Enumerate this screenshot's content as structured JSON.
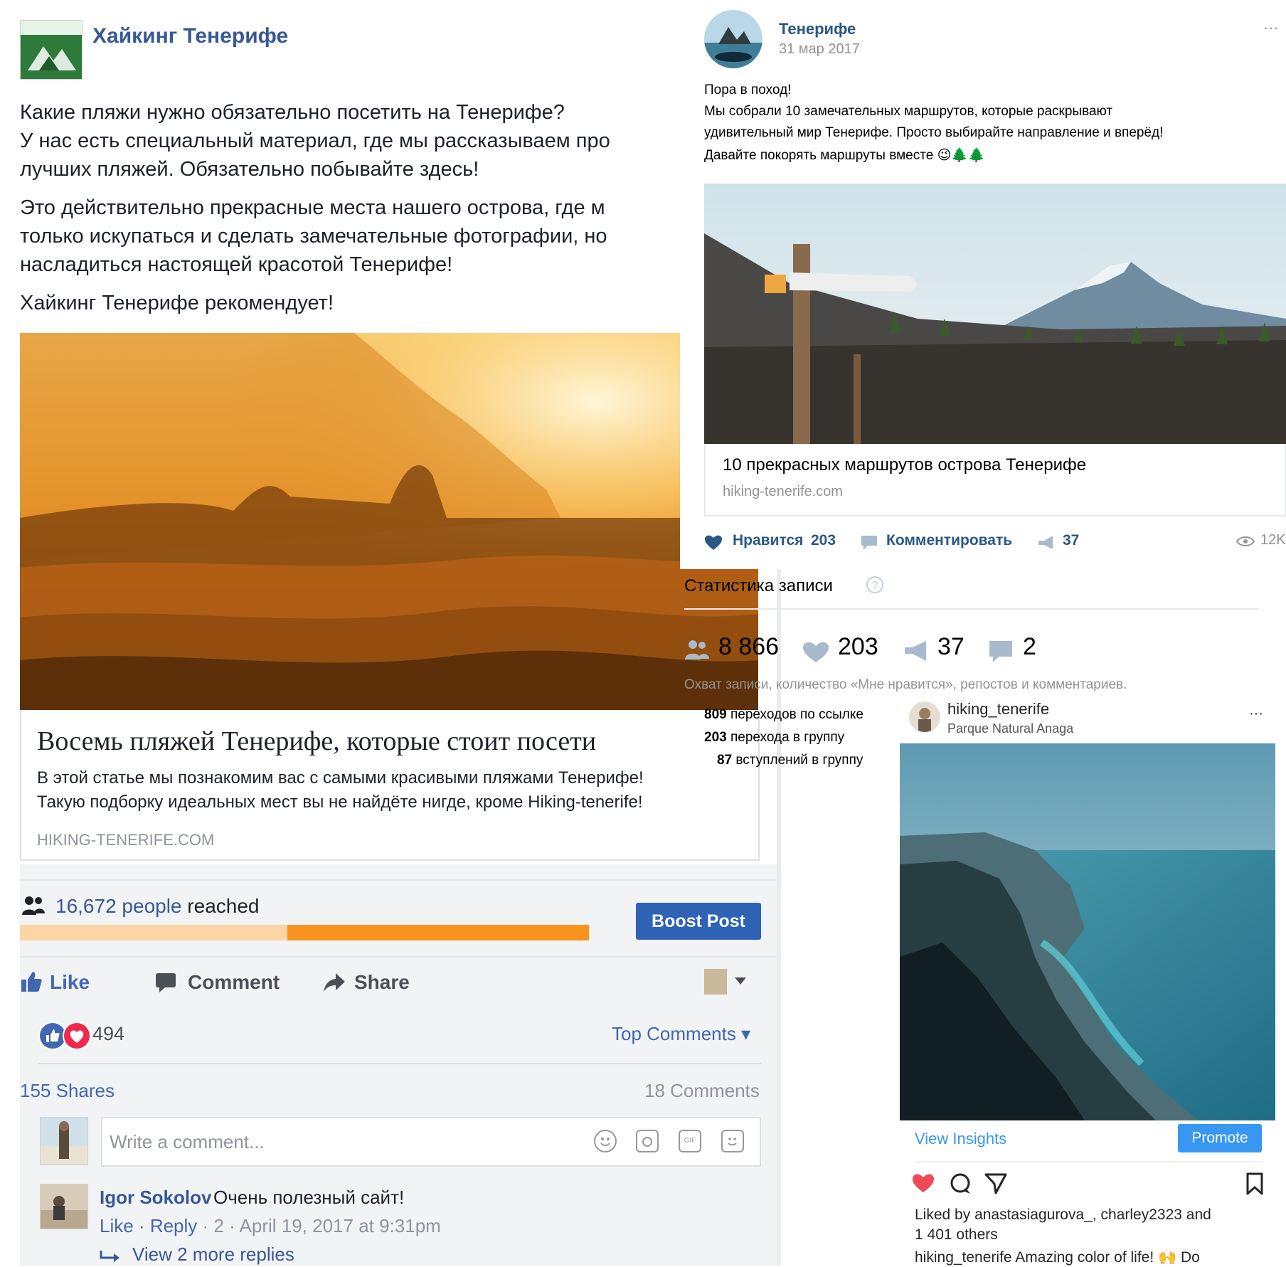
{
  "facebook": {
    "page_name": "Хайкинг Тенерифе",
    "post_lines_p1": [
      "Какие пляжи нужно обязательно посетить на Тенерифе?",
      "У нас есть специальный материал, где мы рассказываем про",
      "лучших пляжей. Обязательно побывайте здесь!"
    ],
    "post_lines_p2": [
      "Это действительно прекрасные места нашего острова, где м",
      "только искупаться и сделать замечательные фотографии, но",
      "насладиться настоящей красотой Тенерифе!"
    ],
    "post_line_p3": "Хайкинг Тенерифе рекомендует!",
    "link": {
      "title": "Восемь пляжей Тенерифе, которые стоит посети",
      "desc_line1": "В этой статье мы познакомим вас с самыми красивыми пляжами Тенерифе!",
      "desc_line2": "Такую подборку идеальных мест вы не найдёте нигде, кроме Hiking-tenerife!",
      "domain": "HIKING-TENERIFE.COM"
    },
    "reach": {
      "people": "16,672 people",
      "suffix": " reached",
      "organic_fraction": 0.47,
      "paid_fraction": 0.53
    },
    "boost_label": "Boost Post",
    "actions": {
      "like": "Like",
      "comment": "Comment",
      "share": "Share"
    },
    "reaction_count": "494",
    "top_comments": "Top Comments ▾",
    "shares": "155 Shares",
    "comments": "18 Comments",
    "comment_placeholder": "Write a comment...",
    "comment": {
      "author": "Igor Sokolov",
      "text": "Очень полезный сайт!",
      "like": "Like",
      "reply": "Reply",
      "meta_rest": " · 2 · April 19, 2017 at 9:31pm",
      "more_replies": "View 2 more replies"
    },
    "colors": {
      "brand": "#4267b2",
      "link": "#365899",
      "boost": "#2e63b6",
      "reach_bar": "#f7931e"
    }
  },
  "vk": {
    "name": "Тенерифе",
    "date": "31 мар 2017",
    "post_lines": [
      "Пора в поход!",
      "Мы собрали 10 замечательных маршрутов, которые раскрывают",
      "удивительный мир Тенерифе. Просто выбирайте направление и вперёд!",
      "Давайте покорять маршруты вместе 😉🌲🌲"
    ],
    "link_title": "10 прекрасных маршрутов острова Тенерифе",
    "link_domain": "hiking-tenerife.com",
    "like_label": "Нравится",
    "like_count": "203",
    "comment_label": "Комментировать",
    "repost_count": "37",
    "views": "12K",
    "stats": {
      "title": "Статистика записи",
      "reach": "8 866",
      "likes": "203",
      "reposts": "37",
      "comments": "2",
      "note": "Охват записи, количество «Мне нравится», репостов и комментариев.",
      "line1_num": "809",
      "line1_text": " переходов по ссылке",
      "line2_num": "203",
      "line2_text": " перехода в группу",
      "line3_num": "87",
      "line3_text": " вступлений в группу"
    },
    "colors": {
      "link": "#2a5885"
    }
  },
  "instagram": {
    "username": "hiking_tenerife",
    "location": "Parque Natural Anaga",
    "insights": "View Insights",
    "promote": "Promote",
    "liked_prefix": "Liked by ",
    "liked_users": "anastasiagurova_, charley2323",
    "liked_suffix": " and",
    "liked_line2": "1 401 others",
    "caption": "hiking_tenerife Amazing color of life! 🙌 Do",
    "colors": {
      "action": "#3897f0",
      "heart": "#ed4956"
    }
  }
}
